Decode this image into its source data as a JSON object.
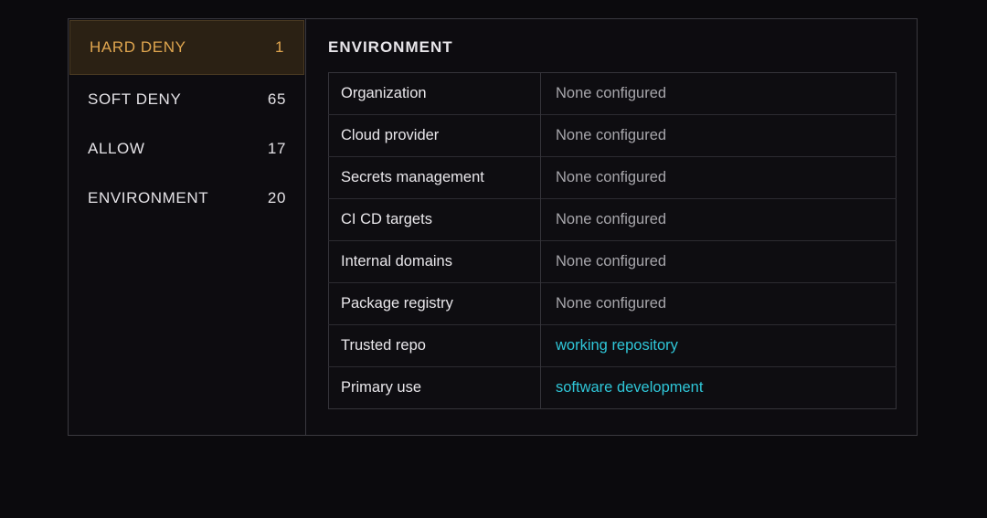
{
  "sidebar": {
    "items": [
      {
        "label": "HARD DENY",
        "count": "1",
        "active": true
      },
      {
        "label": "SOFT DENY",
        "count": "65",
        "active": false
      },
      {
        "label": "ALLOW",
        "count": "17",
        "active": false
      },
      {
        "label": "ENVIRONMENT",
        "count": "20",
        "active": false
      }
    ]
  },
  "main": {
    "title": "ENVIRONMENT",
    "rows": [
      {
        "key": "Organization",
        "value": "None configured",
        "is_link": false
      },
      {
        "key": "Cloud provider",
        "value": "None configured",
        "is_link": false
      },
      {
        "key": "Secrets management",
        "value": "None configured",
        "is_link": false
      },
      {
        "key": "CI CD targets",
        "value": "None configured",
        "is_link": false
      },
      {
        "key": "Internal domains",
        "value": "None configured",
        "is_link": false
      },
      {
        "key": "Package registry",
        "value": "None configured",
        "is_link": false
      },
      {
        "key": "Trusted repo",
        "value": "working repository",
        "is_link": true
      },
      {
        "key": "Primary use",
        "value": "software development",
        "is_link": true
      }
    ]
  },
  "colors": {
    "background": "#0b0a0d",
    "active_accent": "#e0a64f",
    "active_bg": "#2b2114",
    "link": "#2fc6d8"
  }
}
